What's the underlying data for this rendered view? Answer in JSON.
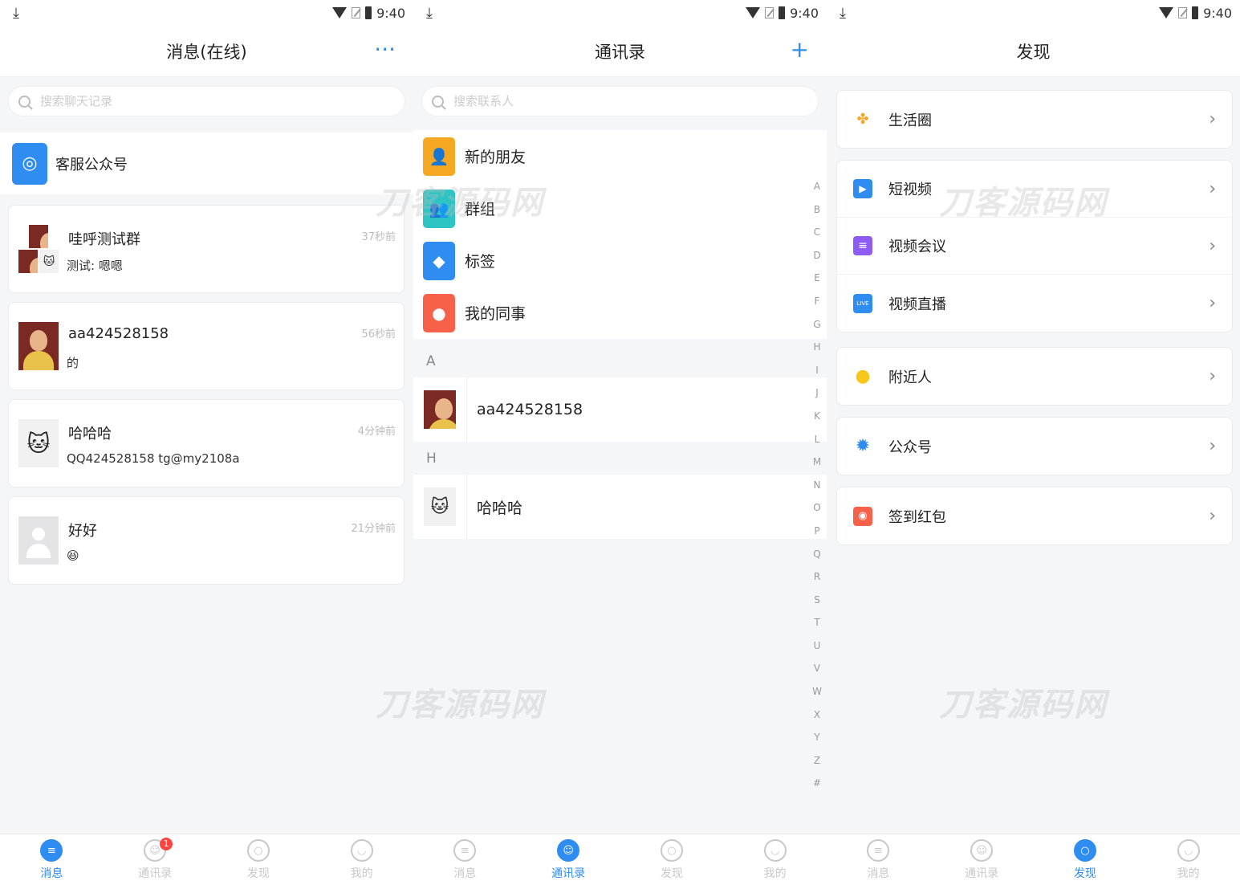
{
  "status": {
    "time": "9:40"
  },
  "watermark": "刀客源码网",
  "messages": {
    "title": "消息(在线)",
    "more_glyph": "···",
    "search_placeholder": "搜索聊天记录",
    "service_label": "客服公众号",
    "chats": [
      {
        "name": "哇呼测试群",
        "message": "测试: 嗯嗯",
        "time": "37秒前"
      },
      {
        "name": "aa424528158",
        "message": "的",
        "time": "56秒前"
      },
      {
        "name": "哈哈哈",
        "message": "QQ424528158 tg@my2108a",
        "time": "4分钟前"
      },
      {
        "name": "好好",
        "message": "😆",
        "time": "21分钟前"
      }
    ]
  },
  "contacts": {
    "title": "通讯录",
    "add_glyph": "+",
    "search_placeholder": "搜索联系人",
    "functions": [
      {
        "label": "新的朋友",
        "color": "#f7a823"
      },
      {
        "label": "群组",
        "color": "#2ec4c4"
      },
      {
        "label": "标签",
        "color": "#2f8cf0"
      },
      {
        "label": "我的同事",
        "color": "#f7614a"
      }
    ],
    "sections": [
      {
        "letter": "A",
        "name": "aa424528158"
      },
      {
        "letter": "H",
        "name": "哈哈哈"
      }
    ],
    "index_letters": [
      "A",
      "B",
      "C",
      "D",
      "E",
      "F",
      "G",
      "H",
      "I",
      "J",
      "K",
      "L",
      "M",
      "N",
      "O",
      "P",
      "Q",
      "R",
      "S",
      "T",
      "U",
      "V",
      "W",
      "X",
      "Y",
      "Z",
      "#"
    ]
  },
  "discover": {
    "title": "发现",
    "items": {
      "life_circle": "生活圈",
      "short_video": "短视频",
      "video_meeting": "视频会议",
      "live": "视频直播",
      "nearby": "附近人",
      "official": "公众号",
      "checkin": "签到红包"
    },
    "chevron": "›",
    "live_badge": "LIVE"
  },
  "tabs": {
    "messages": "消息",
    "contacts": "通讯录",
    "discover": "发现",
    "mine": "我的",
    "contacts_badge": "1"
  },
  "colors": {
    "accent": "#2f8cf0",
    "badge": "#ff4444"
  }
}
